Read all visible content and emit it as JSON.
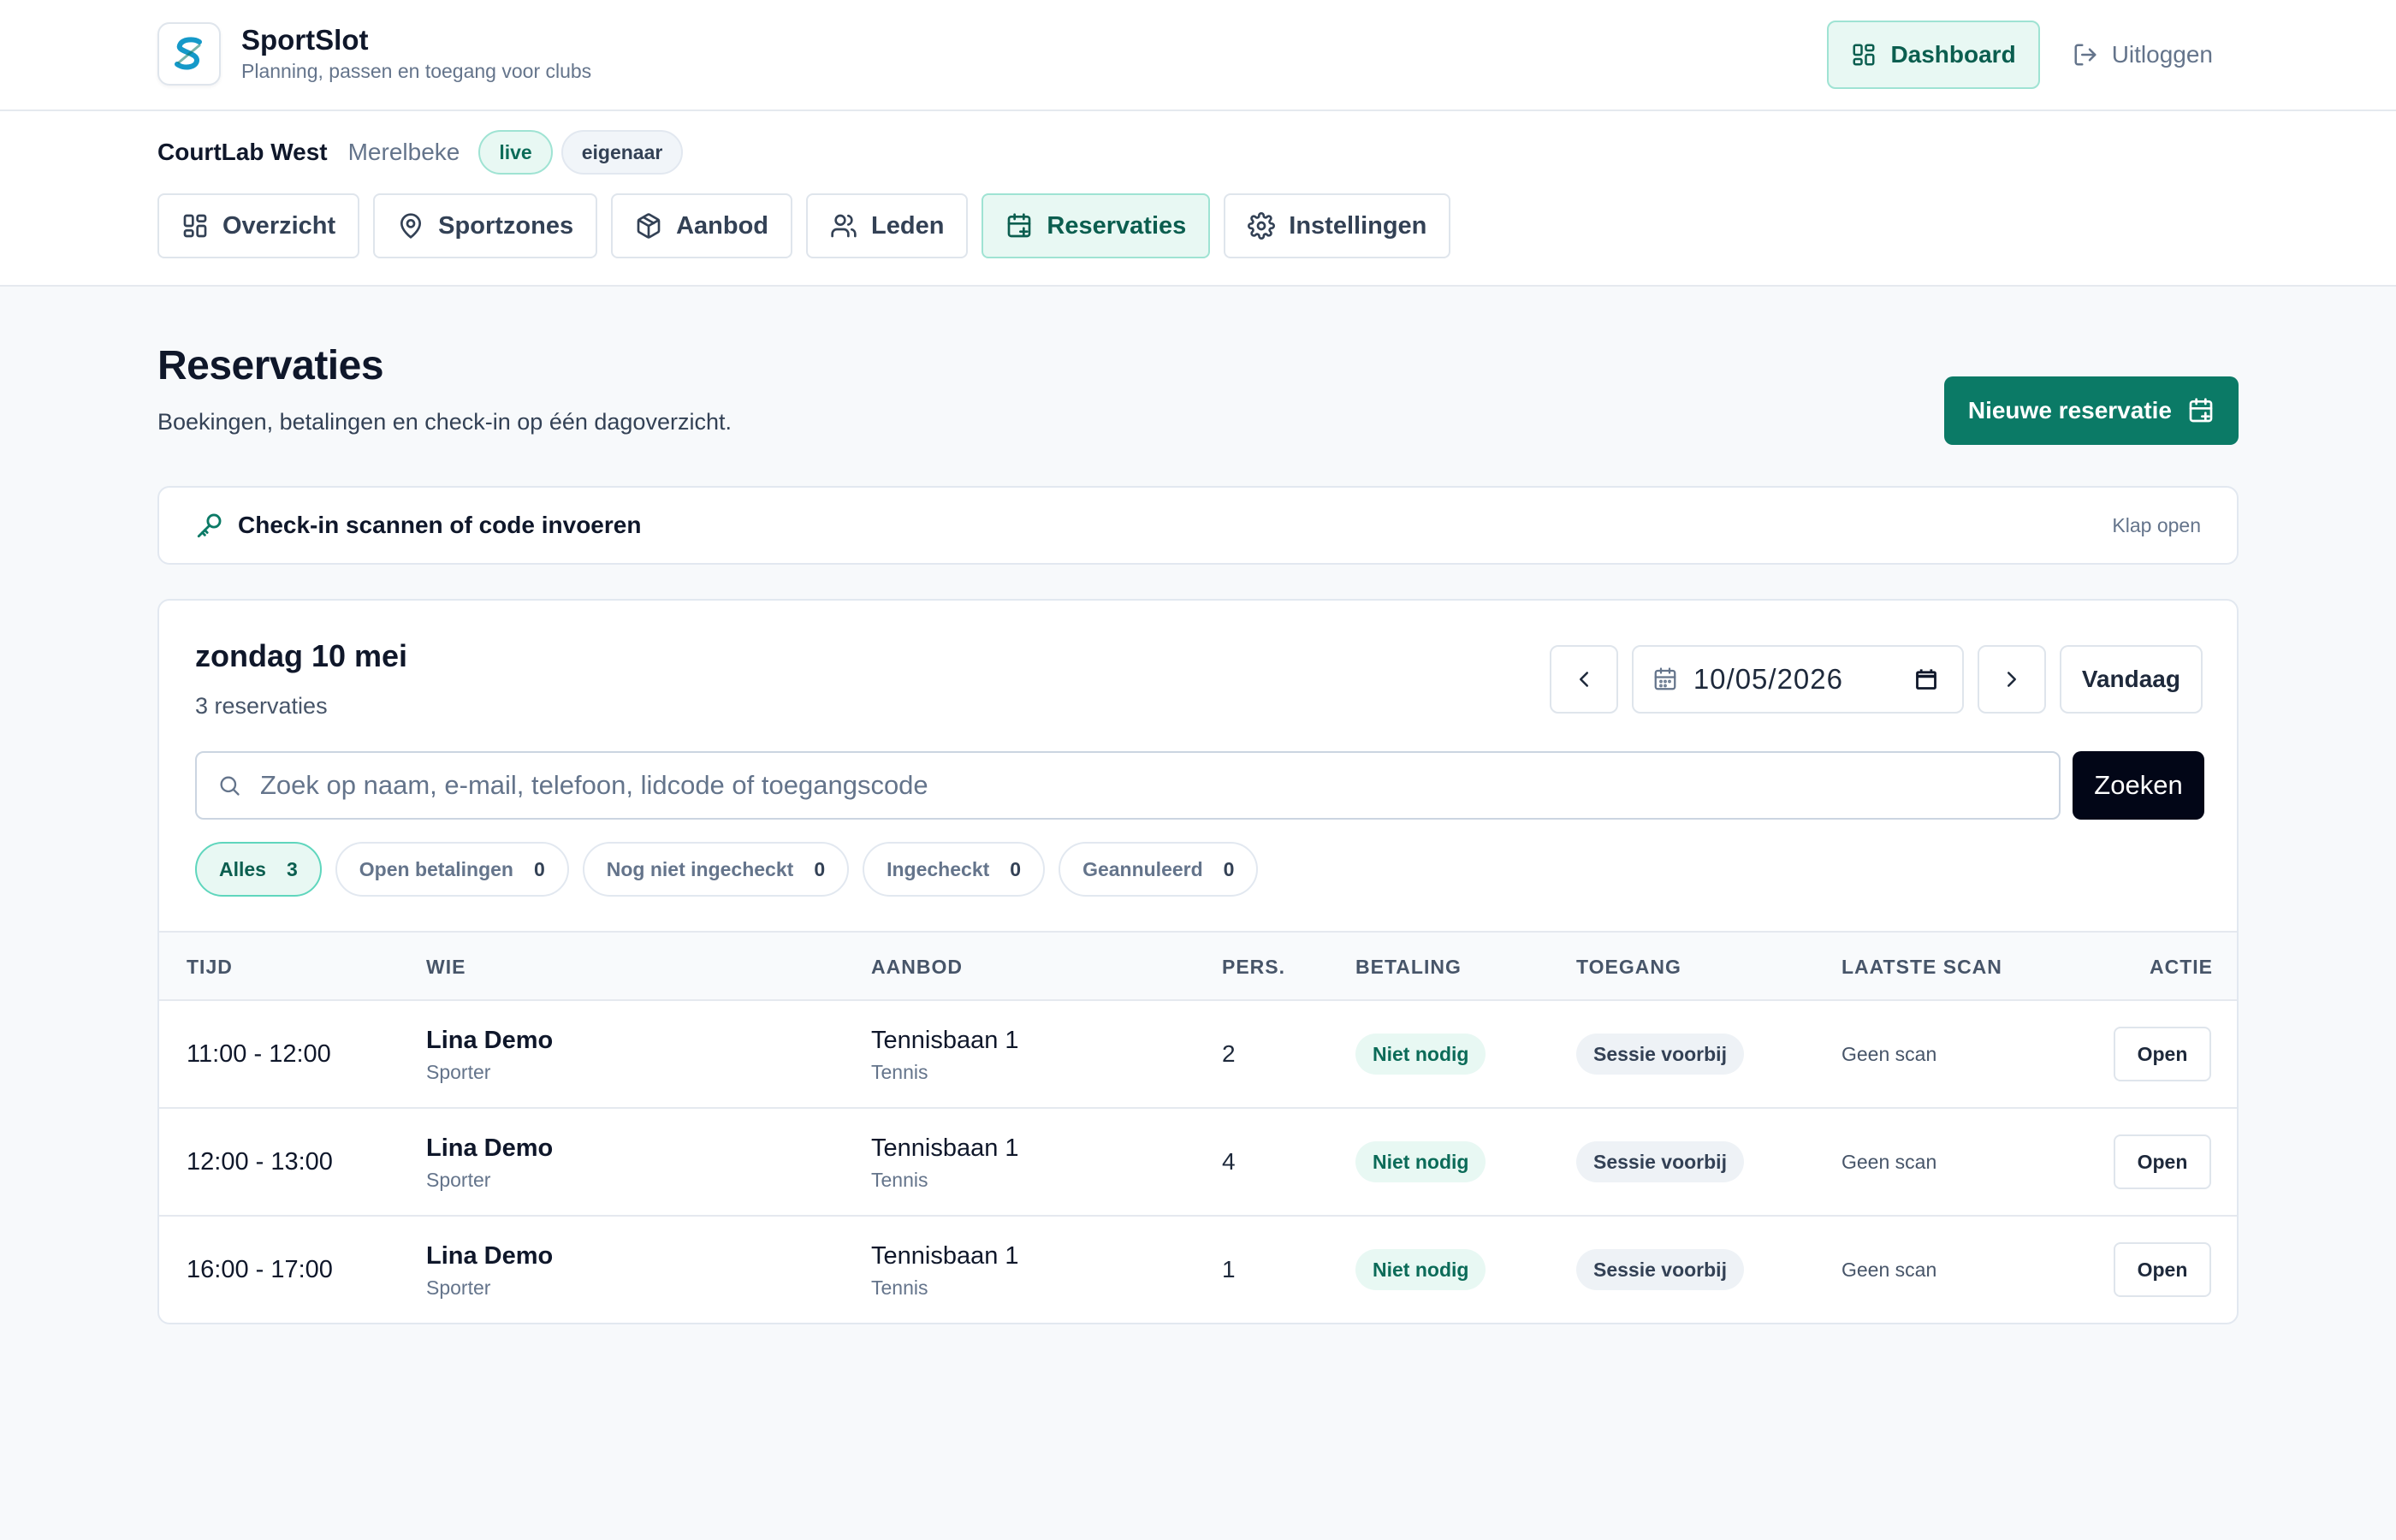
{
  "brand": {
    "name": "SportSlot",
    "tagline": "Planning, passen en toegang voor clubs"
  },
  "header": {
    "dashboard_label": "Dashboard",
    "logout_label": "Uitloggen"
  },
  "club": {
    "name": "CourtLab West",
    "city": "Merelbeke",
    "status_badge": "live",
    "role_badge": "eigenaar"
  },
  "nav": {
    "tabs": [
      {
        "label": "Overzicht",
        "icon": "grid-icon",
        "active": false
      },
      {
        "label": "Sportzones",
        "icon": "map-pin-icon",
        "active": false
      },
      {
        "label": "Aanbod",
        "icon": "box-icon",
        "active": false
      },
      {
        "label": "Leden",
        "icon": "users-icon",
        "active": false
      },
      {
        "label": "Reservaties",
        "icon": "calendar-plus-icon",
        "active": true
      },
      {
        "label": "Instellingen",
        "icon": "gear-icon",
        "active": false
      }
    ]
  },
  "page": {
    "title": "Reservaties",
    "subtitle": "Boekingen, betalingen en check-in op één dagoverzicht.",
    "new_button": "Nieuwe reservatie"
  },
  "checkin": {
    "title": "Check-in scannen of code invoeren",
    "toggle": "Klap open"
  },
  "day": {
    "title": "zondag 10 mei",
    "count": "3 reservaties",
    "date_value": "10/05/2026",
    "today_label": "Vandaag"
  },
  "search": {
    "placeholder": "Zoek op naam, e-mail, telefoon, lidcode of toegangscode",
    "button": "Zoeken"
  },
  "filters": [
    {
      "label": "Alles",
      "count": "3",
      "active": true
    },
    {
      "label": "Open betalingen",
      "count": "0",
      "active": false
    },
    {
      "label": "Nog niet ingecheckt",
      "count": "0",
      "active": false
    },
    {
      "label": "Ingecheckt",
      "count": "0",
      "active": false
    },
    {
      "label": "Geannuleerd",
      "count": "0",
      "active": false
    }
  ],
  "table": {
    "headers": {
      "time": "TIJD",
      "who": "WIE",
      "offer": "AANBOD",
      "persons": "PERS.",
      "payment": "BETALING",
      "access": "TOEGANG",
      "last_scan": "LAATSTE SCAN",
      "action": "ACTIE"
    },
    "rows": [
      {
        "time": "11:00 - 12:00",
        "name": "Lina Demo",
        "role": "Sporter",
        "offer": "Tennisbaan 1",
        "sport": "Tennis",
        "persons": "2",
        "payment": "Niet nodig",
        "access": "Sessie voorbij",
        "last_scan": "Geen scan",
        "action": "Open"
      },
      {
        "time": "12:00 - 13:00",
        "name": "Lina Demo",
        "role": "Sporter",
        "offer": "Tennisbaan 1",
        "sport": "Tennis",
        "persons": "4",
        "payment": "Niet nodig",
        "access": "Sessie voorbij",
        "last_scan": "Geen scan",
        "action": "Open"
      },
      {
        "time": "16:00 - 17:00",
        "name": "Lina Demo",
        "role": "Sporter",
        "offer": "Tennisbaan 1",
        "sport": "Tennis",
        "persons": "1",
        "payment": "Niet nodig",
        "access": "Sessie voorbij",
        "last_scan": "Geen scan",
        "action": "Open"
      }
    ]
  },
  "colors": {
    "accent": "#0b7a66",
    "accent_soft": "#e8f8f3",
    "accent_border": "#9fe3d3",
    "dark_button": "#020617",
    "logo_blue": "#1599c9"
  }
}
